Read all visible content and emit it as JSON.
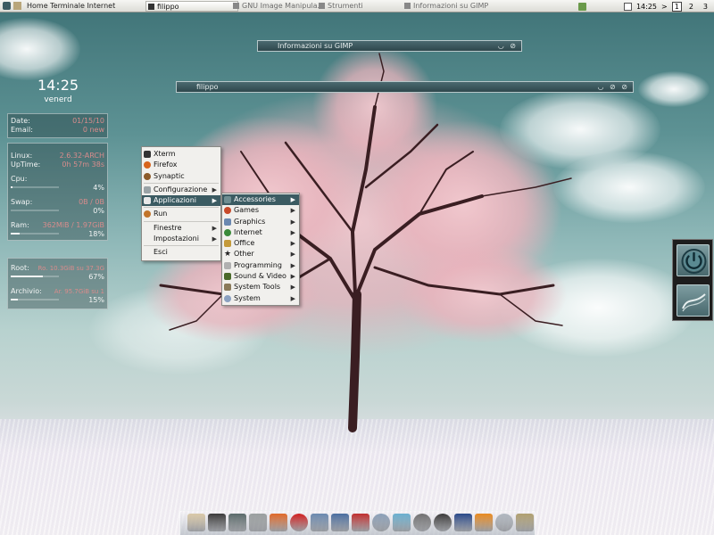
{
  "top_panel": {
    "launchers": "Home Terminale Internet",
    "tasks": [
      {
        "label": "filippo",
        "active": true
      },
      {
        "label": "GNU Image Manipula...",
        "active": false
      },
      {
        "label": "Strumenti",
        "active": false
      },
      {
        "label": "Informazioni su GIMP",
        "active": false
      }
    ],
    "clock": "14:25",
    "arrow": ">",
    "desktops": [
      "1",
      "2",
      "3"
    ],
    "current_desktop": "1"
  },
  "windows": {
    "gimp_about_title": "Informazioni su GIMP",
    "terminal_title": "filippo",
    "buttons": "◡ ⊘",
    "terminal_buttons": "◡ ⊘ ⊘"
  },
  "conky": {
    "time": "14:25",
    "day": "venerd",
    "date_label": "Date:",
    "date_value": "01/15/10",
    "email_label": "Email:",
    "email_value": "0 new",
    "linux_label": "Linux:",
    "linux_value": "2.6.32-ARCH",
    "uptime_label": "UpTime:",
    "uptime_value": "0h 57m 38s",
    "cpu_label": "Cpu:",
    "cpu_pct": "4%",
    "cpu_fill": 0.04,
    "swap_label": "Swap:",
    "swap_value": "0B / 0B",
    "swap_pct": "0%",
    "swap_fill": 0.0,
    "ram_label": "Ram:",
    "ram_value": "362MiB / 1.97GiB",
    "ram_pct": "18%",
    "ram_fill": 0.18,
    "root_label": "Root:",
    "root_value": "Ro. 10.3GiB su 37.3G",
    "root_pct": "67%",
    "root_fill": 0.67,
    "archive_label": "Archivio:",
    "archive_value": "Ar. 95.7GiB su 1",
    "archive_pct": "15%",
    "archive_fill": 0.15
  },
  "main_menu": {
    "items": [
      {
        "label": "Xterm",
        "icon": "terminal-icon",
        "color": "#333333",
        "submenu": false
      },
      {
        "label": "Firefox",
        "icon": "firefox-icon",
        "color": "#d8641c",
        "submenu": false
      },
      {
        "label": "Synaptic",
        "icon": "synaptic-icon",
        "color": "#8c5a2a",
        "submenu": false
      },
      {
        "label": "Configurazione",
        "icon": "config-icon",
        "color": "#9aa3a6",
        "submenu": true
      },
      {
        "label": "Applicazioni",
        "icon": "applications-icon",
        "color": "#e8e8e8",
        "submenu": true,
        "highlighted": true
      },
      {
        "label": "Run",
        "icon": "run-icon",
        "color": "#c2742a",
        "submenu": false
      },
      {
        "label": "Finestre",
        "icon": "",
        "color": "",
        "submenu": true
      },
      {
        "label": "Impostazioni",
        "icon": "",
        "color": "",
        "submenu": true
      },
      {
        "label": "Esci",
        "icon": "",
        "color": "",
        "submenu": false
      }
    ]
  },
  "apps_menu": {
    "items": [
      {
        "label": "Accessories",
        "icon": "accessories-icon",
        "color": "#6f8e92",
        "highlighted": true
      },
      {
        "label": "Games",
        "icon": "games-icon",
        "color": "#c84a2a"
      },
      {
        "label": "Graphics",
        "icon": "graphics-icon",
        "color": "#6a88b0"
      },
      {
        "label": "Internet",
        "icon": "internet-icon",
        "color": "#3a8a3a"
      },
      {
        "label": "Office",
        "icon": "office-icon",
        "color": "#c49a3a"
      },
      {
        "label": "Other",
        "icon": "other-icon",
        "color": "#222222"
      },
      {
        "label": "Programming",
        "icon": "programming-icon",
        "color": "#b0b0b0"
      },
      {
        "label": "Sound & Video",
        "icon": "sound-video-icon",
        "color": "#4a6a2a"
      },
      {
        "label": "System Tools",
        "icon": "system-tools-icon",
        "color": "#8a7a5a"
      },
      {
        "label": "System",
        "icon": "system-icon",
        "color": "#8aa0c0"
      }
    ]
  },
  "right_dock": {
    "items": [
      {
        "icon": "power-icon"
      },
      {
        "icon": "wave-icon"
      }
    ]
  },
  "bottom_dock": {
    "items": [
      {
        "icon": "home-icon",
        "color": "#d9c9a8"
      },
      {
        "icon": "terminal-icon",
        "color": "#3b3b3b"
      },
      {
        "icon": "image-viewer-icon",
        "color": "#5a6a6a"
      },
      {
        "icon": "settings-icon",
        "color": "#9aa0a0"
      },
      {
        "icon": "firefox-icon",
        "color": "#e06a2a"
      },
      {
        "icon": "opera-icon",
        "color": "#d02020"
      },
      {
        "icon": "mail-icon",
        "color": "#6a8ab0"
      },
      {
        "icon": "monitor-icon",
        "color": "#4a6fa0"
      },
      {
        "icon": "music-icon",
        "color": "#c03030"
      },
      {
        "icon": "chat-icon",
        "color": "#8aa0b8"
      },
      {
        "icon": "photo-icon",
        "color": "#6ab0d0"
      },
      {
        "icon": "gimp-icon",
        "color": "#707070"
      },
      {
        "icon": "camera-icon",
        "color": "#3a3a3a"
      },
      {
        "icon": "video-icon",
        "color": "#2a4a8a"
      },
      {
        "icon": "vlc-icon",
        "color": "#e88a20"
      },
      {
        "icon": "disk-icon",
        "color": "#b0b8c0"
      },
      {
        "icon": "tools-icon",
        "color": "#b0a070"
      }
    ]
  },
  "colors": {
    "menu_highlight": "#3b5b62",
    "accent_red": "#d88c8c"
  }
}
